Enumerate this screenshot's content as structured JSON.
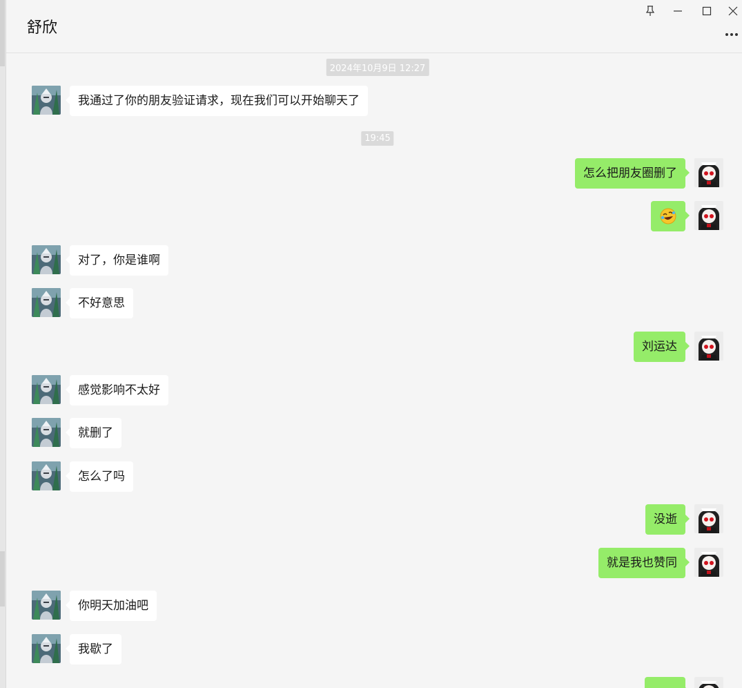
{
  "window": {
    "title": "舒欣",
    "controls": [
      "pin-icon",
      "minimize-icon",
      "maximize-icon",
      "close-icon"
    ],
    "more_icon": "more-dots-icon"
  },
  "colors": {
    "background": "#f5f5f5",
    "incoming_bubble": "#ffffff",
    "outgoing_bubble": "#95ec69",
    "timestamp_bg": "#dadada"
  },
  "chat": {
    "timestamps": [
      "2024年10月9日 12:27",
      "19:45"
    ],
    "messages": [
      {
        "side": "in",
        "text": "我通过了你的朋友验证请求，现在我们可以开始聊天了"
      },
      {
        "side": "out",
        "text": "怎么把朋友圈删了"
      },
      {
        "side": "out",
        "text": "",
        "emoji": "rolling-laughing-emoji"
      },
      {
        "side": "in",
        "text": "对了，你是谁啊"
      },
      {
        "side": "in",
        "text": "不好意思"
      },
      {
        "side": "out",
        "text": "刘运达"
      },
      {
        "side": "in",
        "text": "感觉影响不太好"
      },
      {
        "side": "in",
        "text": "就删了"
      },
      {
        "side": "in",
        "text": "怎么了吗"
      },
      {
        "side": "out",
        "text": "没逝"
      },
      {
        "side": "out",
        "text": "就是我也赞同"
      },
      {
        "side": "in",
        "text": "你明天加油吧"
      },
      {
        "side": "in",
        "text": "我歇了"
      },
      {
        "side": "out",
        "text": ""
      }
    ]
  }
}
